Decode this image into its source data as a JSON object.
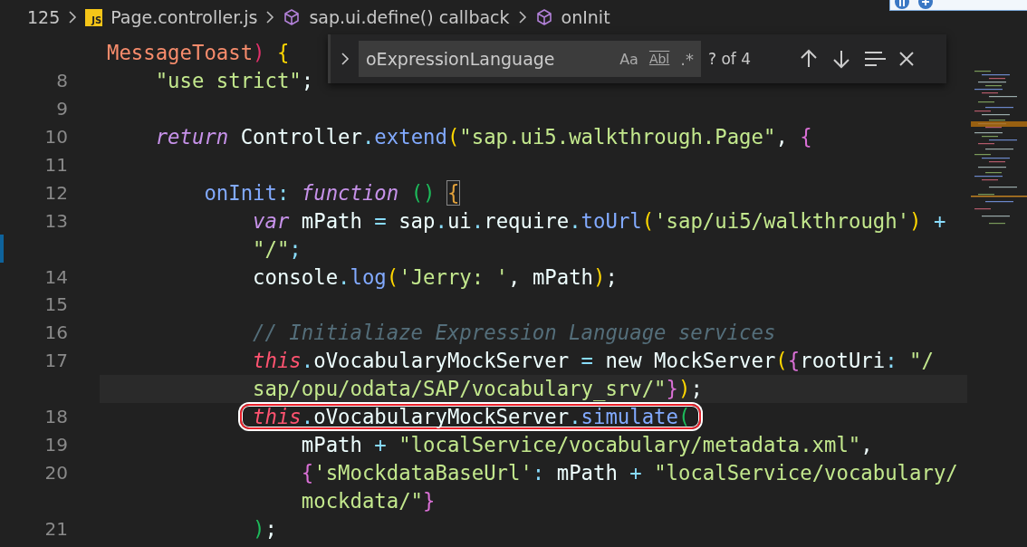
{
  "breadcrumb": {
    "line": "125",
    "items": [
      {
        "kind": "file",
        "badge": "JS",
        "label": "Page.controller.js"
      },
      {
        "kind": "symbol",
        "label": "sap.ui.define() callback"
      },
      {
        "kind": "symbol",
        "label": "onInit"
      }
    ]
  },
  "find_widget": {
    "value": "oExpressionLanguage",
    "options": [
      "Aa",
      "Abl",
      ".*"
    ],
    "match_count": "? of 4"
  },
  "editor": {
    "lines": [
      {
        "current": false,
        "modified": false,
        "outlined": false,
        "tokens": [
          {
            "kind": "param",
            "text": "MessageToast"
          },
          {
            "kind": "brr",
            "text": ")"
          },
          {
            "kind": "br1",
            "text": " {"
          }
        ]
      },
      {
        "number": "8",
        "current": false,
        "modified": false,
        "outlined": false,
        "tokens": [
          {
            "kind": "str",
            "text": "    \"use strict\""
          },
          {
            "kind": "plain",
            "text": ";"
          }
        ]
      },
      {
        "number": "9",
        "current": false,
        "modified": false,
        "outlined": false
      },
      {
        "number": "10",
        "current": false,
        "modified": false,
        "outlined": false,
        "tokens": [
          {
            "kind": "kw",
            "text": "    return"
          },
          {
            "kind": "plain",
            "text": " Controller"
          },
          {
            "kind": "op",
            "text": "."
          },
          {
            "kind": "fn",
            "text": "extend"
          },
          {
            "kind": "br1",
            "text": "("
          },
          {
            "kind": "str",
            "text": "\"sap.ui5.walkthrough.Page\""
          },
          {
            "kind": "plain",
            "text": ", "
          },
          {
            "kind": "br2",
            "text": "{"
          }
        ]
      },
      {
        "number": "11",
        "current": false,
        "modified": false,
        "outlined": false
      },
      {
        "number": "12",
        "current": false,
        "modified": false,
        "outlined": false,
        "tokens": [
          {
            "kind": "fn",
            "text": "        onInit"
          },
          {
            "kind": "op",
            "text": ": "
          },
          {
            "kind": "kw",
            "text": "function "
          },
          {
            "kind": "br3",
            "text": "() "
          },
          {
            "kind": "brbox",
            "text": "{"
          }
        ]
      },
      {
        "number": "13",
        "current": false,
        "modified": false,
        "outlined": false,
        "tokens": [
          {
            "kind": "kw",
            "text": "            var"
          },
          {
            "kind": "plain",
            "text": " mPath "
          },
          {
            "kind": "op",
            "text": "="
          },
          {
            "kind": "plain",
            "text": " sap"
          },
          {
            "kind": "op",
            "text": "."
          },
          {
            "kind": "plain",
            "text": "ui"
          },
          {
            "kind": "op",
            "text": "."
          },
          {
            "kind": "plain",
            "text": "require"
          },
          {
            "kind": "op",
            "text": "."
          },
          {
            "kind": "fn",
            "text": "toUrl"
          },
          {
            "kind": "br1",
            "text": "("
          },
          {
            "kind": "str",
            "text": "'sap/ui5/walkthrough'"
          },
          {
            "kind": "br1",
            "text": ")"
          },
          {
            "kind": "op",
            "text": " +"
          }
        ]
      },
      {
        "current": false,
        "modified": true,
        "outlined": false,
        "tokens": [
          {
            "kind": "str",
            "text": "            \"/\""
          },
          {
            "kind": "op",
            "text": ";"
          }
        ]
      },
      {
        "number": "14",
        "current": false,
        "modified": false,
        "outlined": false,
        "tokens": [
          {
            "kind": "plain",
            "text": "            console"
          },
          {
            "kind": "op",
            "text": "."
          },
          {
            "kind": "fn",
            "text": "log"
          },
          {
            "kind": "br1",
            "text": "("
          },
          {
            "kind": "str",
            "text": "'Jerry: '"
          },
          {
            "kind": "plain",
            "text": ", mPath"
          },
          {
            "kind": "br1",
            "text": ")"
          },
          {
            "kind": "plain",
            "text": ";"
          }
        ]
      },
      {
        "number": "15",
        "current": false,
        "modified": false,
        "outlined": false
      },
      {
        "number": "16",
        "current": false,
        "modified": false,
        "outlined": false,
        "tokens": [
          {
            "kind": "comment",
            "text": "            // Initialiaze Expression Language services"
          }
        ]
      },
      {
        "number": "17",
        "current": false,
        "modified": false,
        "outlined": false,
        "tokens": [
          {
            "kind": "this",
            "text": "            this"
          },
          {
            "kind": "op",
            "text": "."
          },
          {
            "kind": "plain",
            "text": "oVocabularyMockServer "
          },
          {
            "kind": "op",
            "text": "="
          },
          {
            "kind": "plain",
            "text": " new MockServer"
          },
          {
            "kind": "br1",
            "text": "("
          },
          {
            "kind": "br2",
            "text": "{"
          },
          {
            "kind": "plain",
            "text": "rootUri"
          },
          {
            "kind": "op",
            "text": ":"
          },
          {
            "kind": "str",
            "text": " \"/"
          }
        ]
      },
      {
        "current": true,
        "modified": false,
        "outlined": false,
        "tokens": [
          {
            "kind": "str",
            "text": "            sap/opu/odata/SAP/vocabulary_srv/\""
          },
          {
            "kind": "br2",
            "text": "}"
          },
          {
            "kind": "br1",
            "text": ")"
          },
          {
            "kind": "plain",
            "text": ";"
          }
        ]
      },
      {
        "number": "18",
        "current": false,
        "modified": false,
        "outlined": true,
        "tokens": [
          {
            "kind": "this",
            "text": "            this"
          },
          {
            "kind": "member",
            "text": ".oVocabularyMockServer"
          },
          {
            "kind": "method",
            "text": ".simulate"
          },
          {
            "kind": "br3",
            "text": "("
          }
        ]
      },
      {
        "number": "19",
        "current": false,
        "modified": false,
        "outlined": false,
        "tokens": [
          {
            "kind": "plain",
            "text": "                mPath "
          },
          {
            "kind": "op",
            "text": "+"
          },
          {
            "kind": "str",
            "text": " \"localService/vocabulary/metadata.xml\""
          },
          {
            "kind": "plain",
            "text": ","
          }
        ]
      },
      {
        "number": "20",
        "current": false,
        "modified": false,
        "outlined": false,
        "tokens": [
          {
            "kind": "br2",
            "text": "                {"
          },
          {
            "kind": "str",
            "text": "'sMockdataBaseUrl'"
          },
          {
            "kind": "op",
            "text": ":"
          },
          {
            "kind": "plain",
            "text": " mPath "
          },
          {
            "kind": "op",
            "text": "+"
          },
          {
            "kind": "str",
            "text": " \"localService/vocabulary/"
          }
        ]
      },
      {
        "current": false,
        "modified": false,
        "outlined": false,
        "tokens": [
          {
            "kind": "str",
            "text": "                mockdata/\""
          },
          {
            "kind": "br2",
            "text": "}"
          }
        ]
      },
      {
        "number": "21",
        "current": false,
        "modified": false,
        "outlined": false,
        "tokens": [
          {
            "kind": "br3",
            "text": "            )"
          },
          {
            "kind": "plain",
            "text": ";"
          }
        ]
      }
    ]
  }
}
